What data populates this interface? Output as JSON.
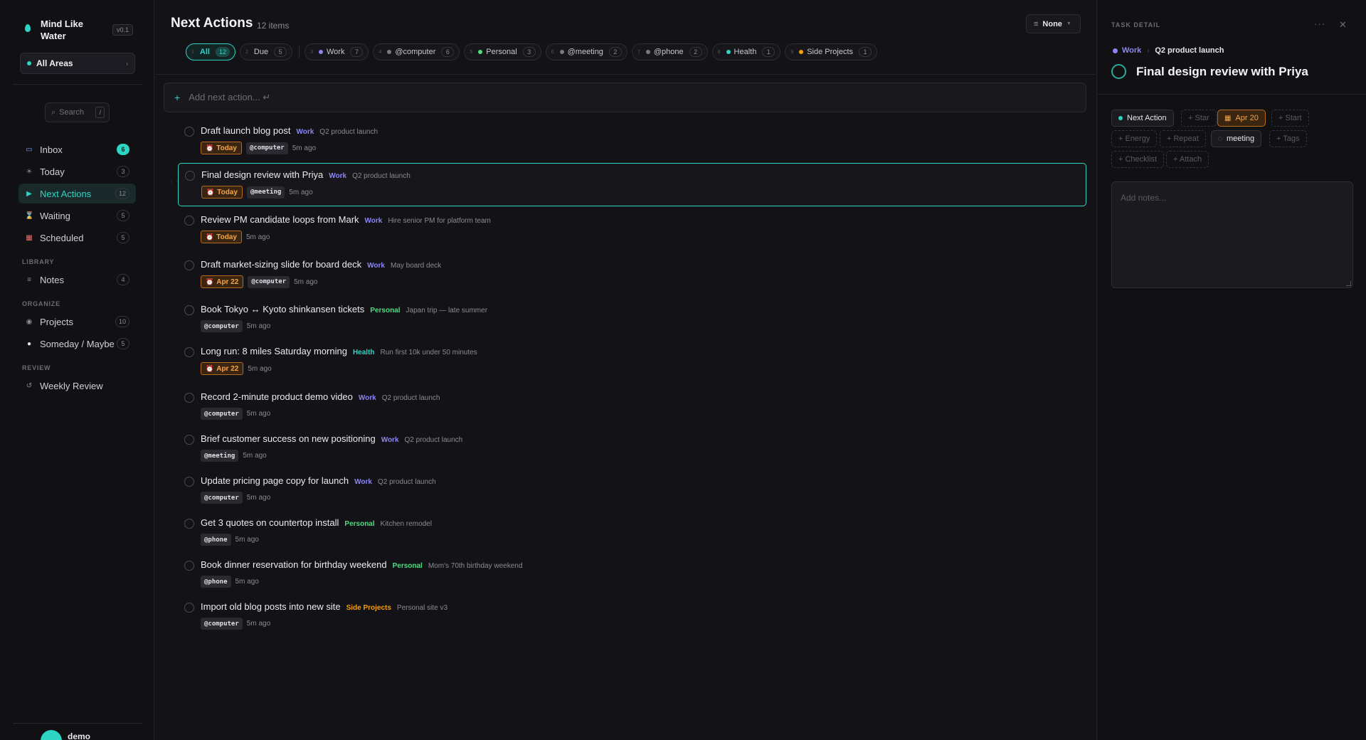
{
  "sidebar": {
    "app_name": "Mind Like Water",
    "version": "v0.1",
    "area_selector": "All Areas",
    "search_placeholder": "Search",
    "search_shortcut": "/",
    "nav": [
      {
        "label": "Inbox",
        "count": "6",
        "icon": "inbox-icon"
      },
      {
        "label": "Today",
        "count": "3",
        "icon": "sun-icon"
      },
      {
        "label": "Next Actions",
        "count": "12",
        "icon": "play-icon"
      },
      {
        "label": "Waiting",
        "count": "5",
        "icon": "hourglass-icon"
      },
      {
        "label": "Scheduled",
        "count": "5",
        "icon": "calendar-icon"
      }
    ],
    "library_label": "LIBRARY",
    "library": [
      {
        "label": "Notes",
        "count": "4",
        "icon": "list-icon"
      }
    ],
    "organize_label": "ORGANIZE",
    "organize": [
      {
        "label": "Projects",
        "count": "10",
        "icon": "target-icon"
      },
      {
        "label": "Someday / Maybe",
        "count": "5",
        "icon": "thought-bubble-icon"
      }
    ],
    "review_label": "REVIEW",
    "review": [
      {
        "label": "Weekly Review",
        "icon": "refresh-icon"
      }
    ],
    "user": "demo"
  },
  "header": {
    "title": "Next Actions",
    "count": "12 items",
    "sort_label": "None"
  },
  "filters": [
    {
      "key": "1",
      "label": "All",
      "count": "12"
    },
    {
      "key": "2",
      "label": "Due",
      "count": "5"
    },
    {
      "key": "3",
      "label": "Work",
      "count": "7"
    },
    {
      "key": "4",
      "label": "@computer",
      "count": "6"
    },
    {
      "key": "5",
      "label": "Personal",
      "count": "3"
    },
    {
      "key": "6",
      "label": "@meeting",
      "count": "2"
    },
    {
      "key": "7",
      "label": "@phone",
      "count": "2"
    },
    {
      "key": "8",
      "label": "Health",
      "count": "1"
    },
    {
      "key": "9",
      "label": "Side Projects",
      "count": "1"
    }
  ],
  "add_placeholder": "Add next action... ↵",
  "tasks": [
    {
      "title": "Draft launch blog post",
      "area": "Work",
      "project": "Q2 product launch",
      "due": "Today",
      "context": "@computer",
      "ago": "5m ago"
    },
    {
      "title": "Final design review with Priya",
      "area": "Work",
      "project": "Q2 product launch",
      "due": "Today",
      "context": "@meeting",
      "ago": "5m ago"
    },
    {
      "title": "Review PM candidate loops from Mark",
      "area": "Work",
      "project": "Hire senior PM for platform team",
      "due": "Today",
      "context": "",
      "ago": "5m ago"
    },
    {
      "title": "Draft market-sizing slide for board deck",
      "area": "Work",
      "project": "May board deck",
      "due": "Apr 22",
      "context": "@computer",
      "ago": "5m ago"
    },
    {
      "title": "Book Tokyo ↔ Kyoto shinkansen tickets",
      "area": "Personal",
      "project": "Japan trip — late summer",
      "due": "",
      "context": "@computer",
      "ago": "5m ago"
    },
    {
      "title": "Long run: 8 miles Saturday morning",
      "area": "Health",
      "project": "Run first 10k under 50 minutes",
      "due": "Apr 22",
      "context": "",
      "ago": "5m ago"
    },
    {
      "title": "Record 2-minute product demo video",
      "area": "Work",
      "project": "Q2 product launch",
      "due": "",
      "context": "@computer",
      "ago": "5m ago"
    },
    {
      "title": "Brief customer success on new positioning",
      "area": "Work",
      "project": "Q2 product launch",
      "due": "",
      "context": "@meeting",
      "ago": "5m ago"
    },
    {
      "title": "Update pricing page copy for launch",
      "area": "Work",
      "project": "Q2 product launch",
      "due": "",
      "context": "@computer",
      "ago": "5m ago"
    },
    {
      "title": "Get 3 quotes on countertop install",
      "area": "Personal",
      "project": "Kitchen remodel",
      "due": "",
      "context": "@phone",
      "ago": "5m ago"
    },
    {
      "title": "Book dinner reservation for birthday weekend",
      "area": "Personal",
      "project": "Mom's 70th birthday weekend",
      "due": "",
      "context": "@phone",
      "ago": "5m ago"
    },
    {
      "title": "Import old blog posts into new site",
      "area": "Side Projects",
      "project": "Personal site v3",
      "due": "",
      "context": "@computer",
      "ago": "5m ago"
    }
  ],
  "colors": {
    "accent": "#2dd4c4",
    "Work": "#8b86f2",
    "Personal": "#4ade80",
    "Health": "#2dd4c4",
    "Side Projects": "#f59e0b",
    "due": "#f3a54a"
  },
  "detail": {
    "label": "TASK DETAIL",
    "area": "Work",
    "project": "Q2 product launch",
    "title": "Final design review with Priya",
    "status": "Next Action",
    "star": "+ Star",
    "due": "Apr 20",
    "start": "+ Start",
    "energy": "+ Energy",
    "repeat": "+ Repeat",
    "context": "meeting",
    "tags": "+ Tags",
    "checklist": "+ Checklist",
    "attach": "+ Attach",
    "notes_placeholder": "Add notes..."
  }
}
